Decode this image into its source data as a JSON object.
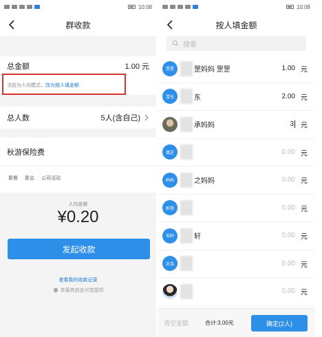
{
  "statusbar": {
    "time": "10:08"
  },
  "left": {
    "title": "群收款",
    "amount_label": "总金额",
    "amount_value": "1.00 元",
    "mode_text": "当前为人均模式，",
    "mode_link": "改为按人填金额",
    "people_label": "总人数",
    "people_value": "5人(含自己)",
    "topic": "秋游保险费",
    "tags": [
      "聚餐",
      "聚会",
      "公司活动"
    ],
    "per_label": "人均金额",
    "per_value": "¥0.20",
    "launch_button": "发起收款",
    "records_link": "查看我的收款记录",
    "provider": "本服务由支付宝提供"
  },
  "right": {
    "title": "按人填金额",
    "search_placeholder": "搜索",
    "members": [
      {
        "avatar": "罡罡",
        "name": "罡妈妈 罡罡",
        "amount": "1.00",
        "unit": "元"
      },
      {
        "avatar": "雪东",
        "name": "东",
        "amount": "2.00",
        "unit": "元"
      },
      {
        "avatar": "",
        "name": "承妈妈",
        "amount": "3",
        "unit": "元"
      },
      {
        "avatar": "蔼芝",
        "name": "",
        "amount": "0.00",
        "unit": "元"
      },
      {
        "avatar": "妈妈",
        "name": "之妈妈",
        "amount": "0.00",
        "unit": "元"
      },
      {
        "avatar": "即扬",
        "name": "",
        "amount": "0.00",
        "unit": "元"
      },
      {
        "avatar": "浩轩",
        "name": "轩",
        "amount": "0.00",
        "unit": "元"
      },
      {
        "avatar": "正浩",
        "name": "",
        "amount": "0.00",
        "unit": "元"
      },
      {
        "avatar": "",
        "name": "",
        "amount": "0.00",
        "unit": "元"
      }
    ],
    "clear_button": "清空金额",
    "total": "合计:3.00元",
    "confirm_button": "确定(2人)"
  },
  "colors": {
    "accent": "#2d8fe8",
    "highlight_box": "#d9312e"
  }
}
